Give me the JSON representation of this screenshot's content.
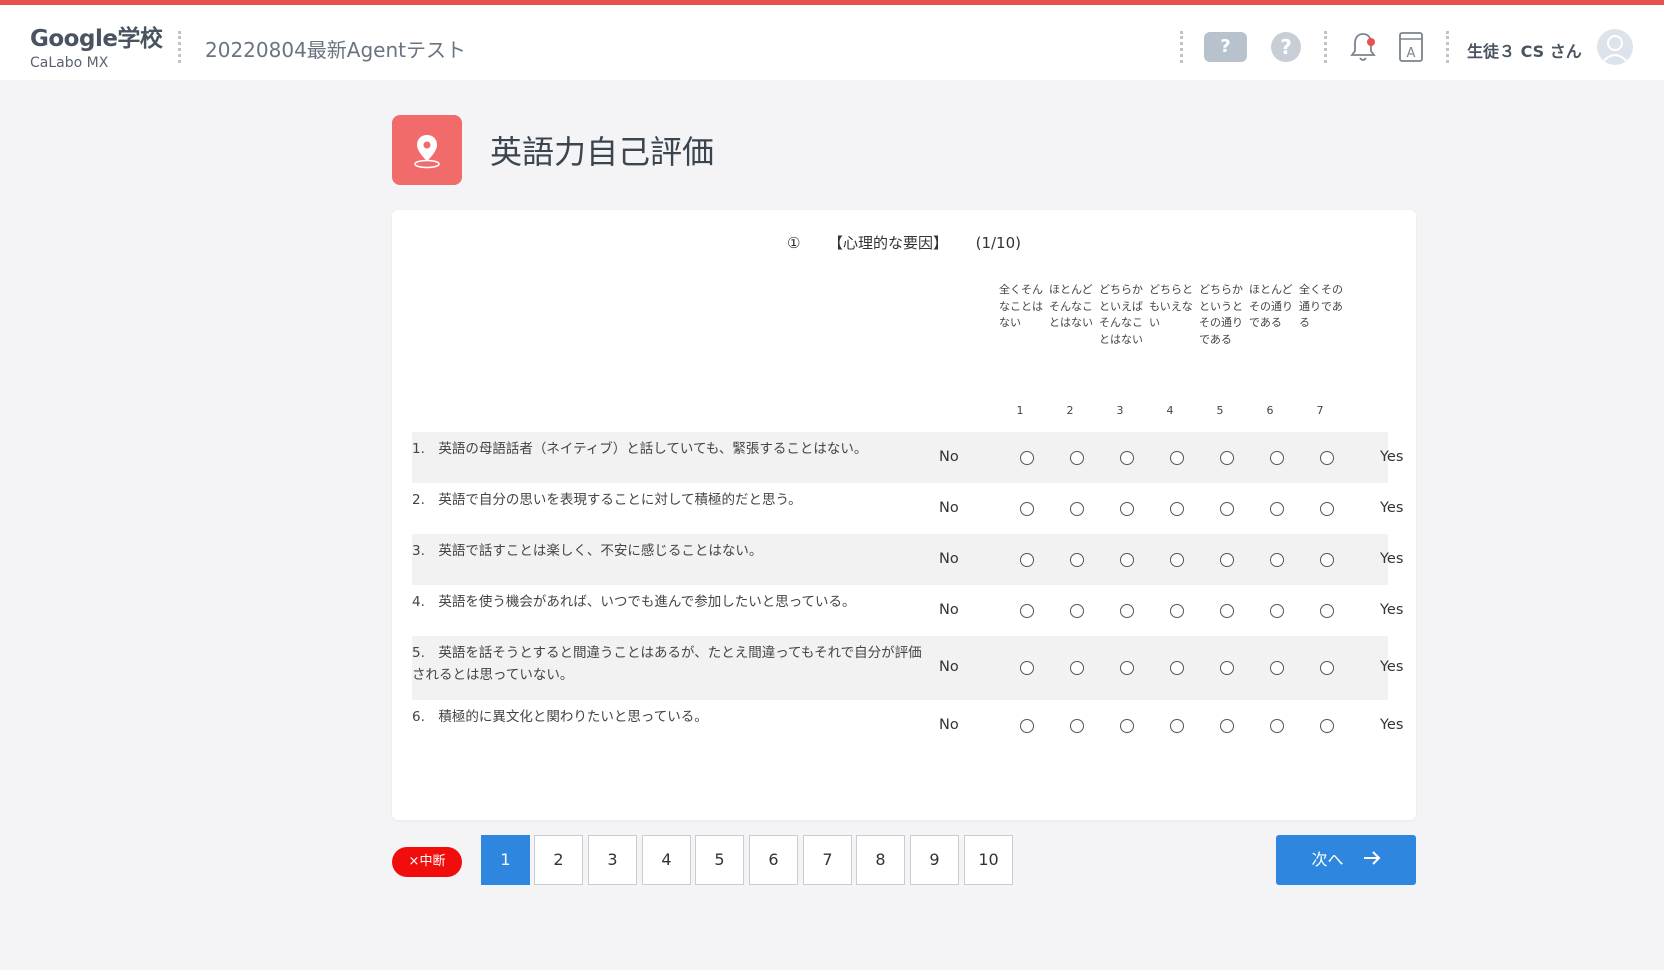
{
  "header": {
    "school_name": "Google学校",
    "brand": "CaLabo MX",
    "course": "20220804最新Agentテスト",
    "help_label": "?",
    "help_circle_label": "?",
    "user_name": "生徒３ CS さん"
  },
  "page": {
    "title": "英語力自己評価"
  },
  "section": {
    "number": "①",
    "name": "【心理的な要因】",
    "progress": "(1/10)"
  },
  "scale": [
    {
      "label": "全くそんなことはない",
      "num": "1"
    },
    {
      "label": "ほとんどそんなことはない",
      "num": "2"
    },
    {
      "label": "どちらかといえばそんなことはない",
      "num": "3"
    },
    {
      "label": "どちらともいえない",
      "num": "4"
    },
    {
      "label": "どちらかというとその通りである",
      "num": "5"
    },
    {
      "label": "ほとんどその通りである",
      "num": "6"
    },
    {
      "label": "全くその通りである",
      "num": "7"
    }
  ],
  "labels": {
    "no": "No",
    "yes": "Yes"
  },
  "questions": [
    {
      "text": "1.　英語の母語話者（ネイティブ）と話していても、緊張することはない。"
    },
    {
      "text": "2.　英語で自分の思いを表現することに対して積極的だと思う。"
    },
    {
      "text": "3.　英語で話すことは楽しく、不安に感じることはない。"
    },
    {
      "text": "4.　英語を使う機会があれば、いつでも進んで参加したいと思っている。"
    },
    {
      "text": "5.　英語を話そうとすると間違うことはあるが、たとえ間違ってもそれで自分が評価されるとは思っていない。"
    },
    {
      "text": "6.　積極的に異文化と関わりたいと思っている。"
    }
  ],
  "footer": {
    "suspend_label": "×中断",
    "pages": [
      "1",
      "2",
      "3",
      "4",
      "5",
      "6",
      "7",
      "8",
      "9",
      "10"
    ],
    "current_page": "1",
    "next_label": "次へ"
  },
  "colors": {
    "accent": "#2e86de",
    "top_border": "#e8514f",
    "title_icon": "#f26b6b",
    "suspend": "#f20d0d"
  }
}
